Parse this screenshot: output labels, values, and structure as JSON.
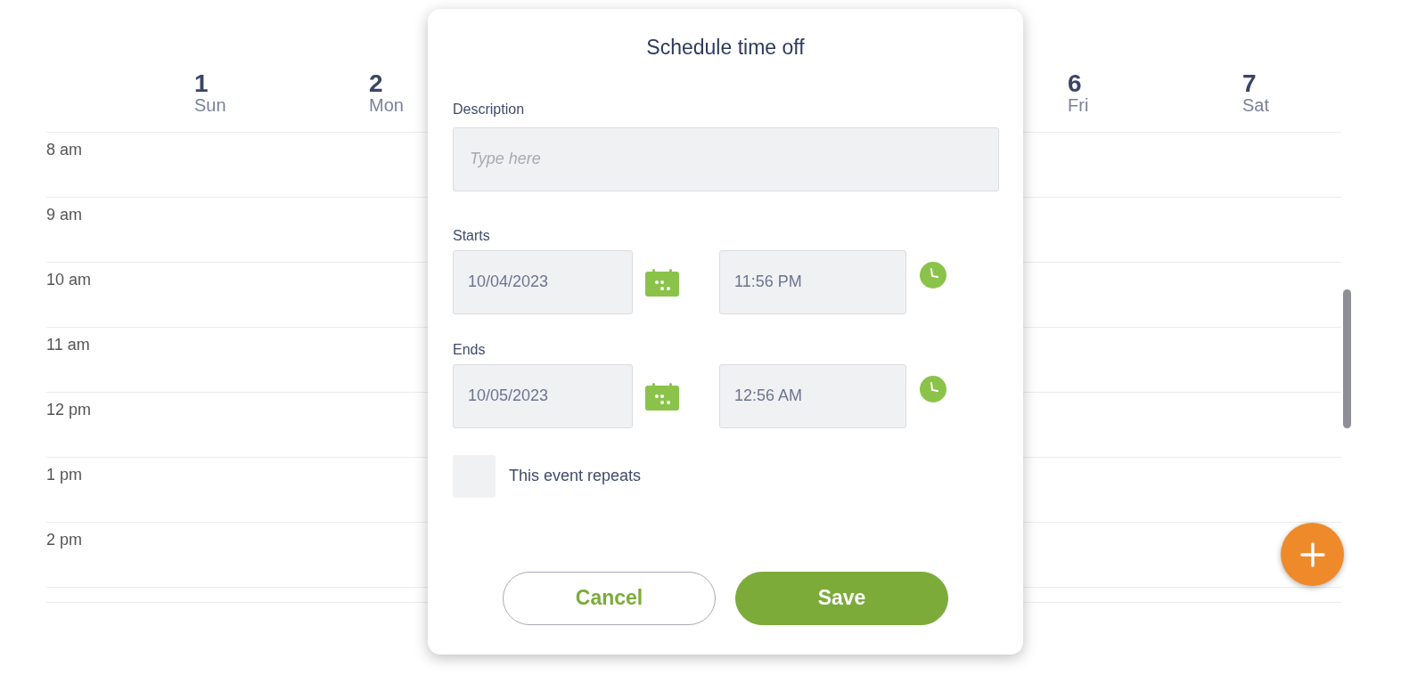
{
  "calendar": {
    "days_left": [
      {
        "number": "1",
        "weekday": "Sun"
      },
      {
        "number": "2",
        "weekday": "Mon"
      }
    ],
    "days_right": [
      {
        "number": "6",
        "weekday": "Fri"
      },
      {
        "number": "7",
        "weekday": "Sat"
      }
    ],
    "times": [
      "8 am",
      "9 am",
      "10 am",
      "11 am",
      "12 pm",
      "1 pm",
      "2 pm"
    ]
  },
  "dialog": {
    "title": "Schedule time off",
    "description": {
      "label": "Description",
      "placeholder": "Type here"
    },
    "starts": {
      "label": "Starts",
      "date": "10/04/2023",
      "time": "11:56 PM"
    },
    "ends": {
      "label": "Ends",
      "date": "10/05/2023",
      "time": "12:56 AM"
    },
    "repeats": {
      "label": "This event repeats",
      "checked": false
    },
    "buttons": [
      {
        "label": "Cancel",
        "kind": "secondary"
      },
      {
        "label": "Save",
        "kind": "primary"
      }
    ]
  }
}
